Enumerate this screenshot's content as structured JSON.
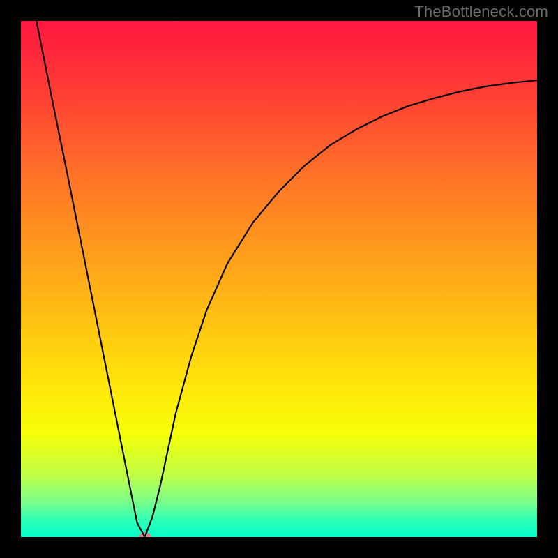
{
  "watermark": "TheBottleneck.com",
  "chart_data": {
    "type": "line",
    "title": "",
    "xlabel": "",
    "ylabel": "",
    "xlim": [
      0,
      100
    ],
    "ylim": [
      0,
      100
    ],
    "grid": false,
    "legend_position": "none",
    "gradient_stops": [
      {
        "offset": 0.0,
        "color": "#ff173f"
      },
      {
        "offset": 0.12,
        "color": "#ff3836"
      },
      {
        "offset": 0.3,
        "color": "#ff7227"
      },
      {
        "offset": 0.5,
        "color": "#ffab18"
      },
      {
        "offset": 0.7,
        "color": "#ffe40a"
      },
      {
        "offset": 0.8,
        "color": "#f6ff08"
      },
      {
        "offset": 0.88,
        "color": "#bfff45"
      },
      {
        "offset": 0.93,
        "color": "#7dff88"
      },
      {
        "offset": 0.97,
        "color": "#29ffba"
      },
      {
        "offset": 1.0,
        "color": "#06ffcc"
      }
    ],
    "series": [
      {
        "name": "bottleneck-curve",
        "color": "#000000",
        "x": [
          3.0,
          6.0,
          9.0,
          12.0,
          15.0,
          18.0,
          21.0,
          22.5,
          24.0,
          25.5,
          27.0,
          28.5,
          30.0,
          33.0,
          36.0,
          40.0,
          45.0,
          50.0,
          55.0,
          60.0,
          65.0,
          70.0,
          75.0,
          80.0,
          85.0,
          90.0,
          95.0,
          100.0
        ],
        "y": [
          100.0,
          85.0,
          70.3,
          55.3,
          40.3,
          25.3,
          10.3,
          2.8,
          0.0,
          4.0,
          10.0,
          17.0,
          24.0,
          35.0,
          44.0,
          53.0,
          61.0,
          67.0,
          72.0,
          76.0,
          79.0,
          81.5,
          83.5,
          85.0,
          86.3,
          87.3,
          88.0,
          88.5
        ]
      }
    ],
    "marker": {
      "name": "optimal-point",
      "x": 24.0,
      "y": 0.0,
      "color": "#d48b8b"
    }
  }
}
